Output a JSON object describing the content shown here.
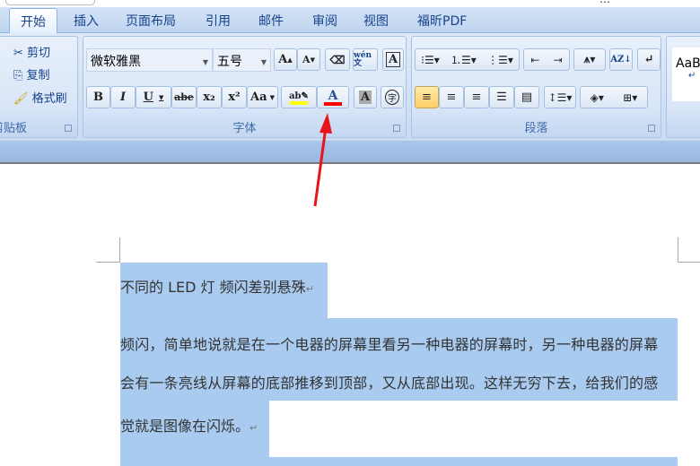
{
  "title_fragment": "…",
  "tabs": [
    "开始",
    "插入",
    "页面布局",
    "引用",
    "邮件",
    "审阅",
    "视图",
    "福昕PDF"
  ],
  "clipboard": {
    "cut": "剪切",
    "copy": "复制",
    "format_painter": "格式刷",
    "label": "剪贴板"
  },
  "font": {
    "name": "微软雅黑",
    "size": "五号",
    "label": "字体",
    "bold": "B",
    "italic": "I",
    "underline": "U",
    "strike": "abe",
    "sub": "x₂",
    "sup": "x²",
    "case": "Aa",
    "grow": "A",
    "shrink": "A",
    "phonetic": "wén 文",
    "border_char": "A",
    "font_color": "A",
    "shade": "A",
    "enclose": "字",
    "highlight_color": "#ffff00",
    "font_color_value": "#ff0000"
  },
  "paragraph": {
    "label": "段落"
  },
  "styles": {
    "preview": "AaB"
  },
  "document": {
    "lines": [
      "不同的 LED 灯 频闪差别悬殊",
      "频闪，简单地说就是在一个电器的屏幕里看另一种电器的屏幕时，另一种电器的屏幕",
      "会有一条亮线从屏幕的底部推移到顶部，又从底部出现。这样无穷下去，给我们的感",
      "觉就是图像在闪烁。"
    ],
    "para_mark": "↵"
  }
}
